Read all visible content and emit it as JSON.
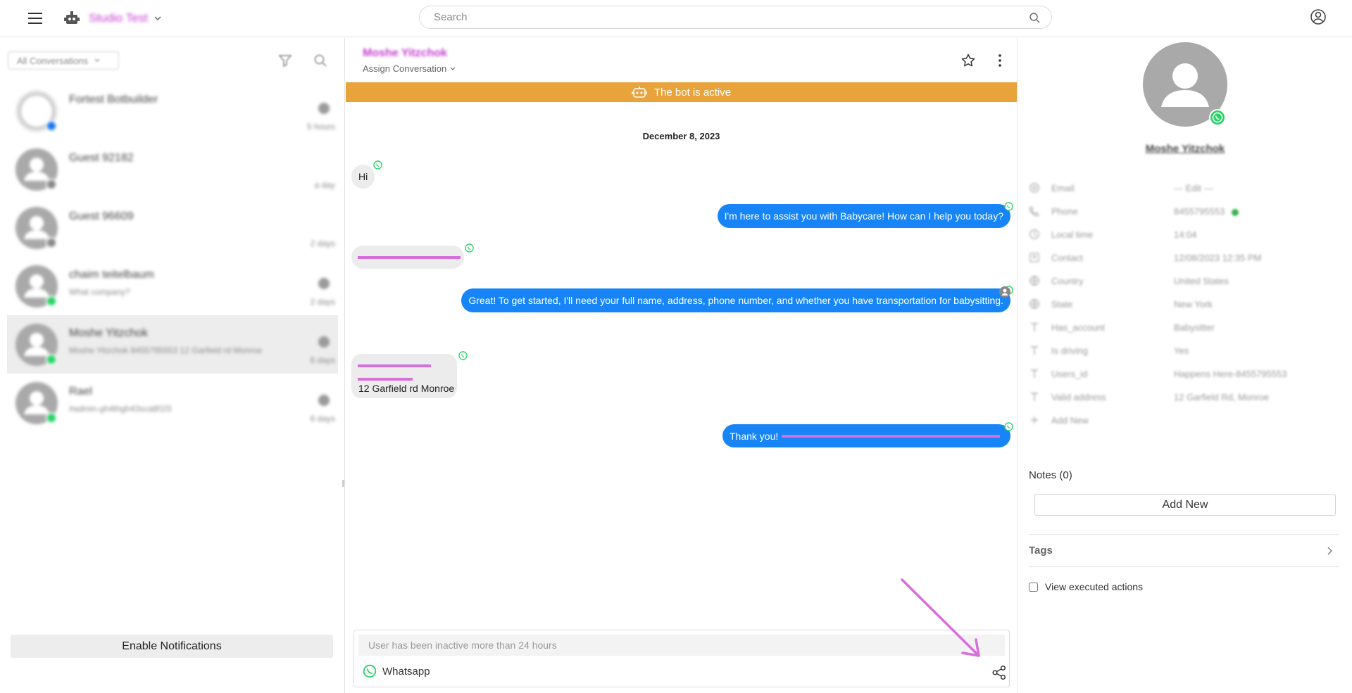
{
  "topbar": {
    "workspace_name": "Studio Test",
    "search_placeholder": "Search"
  },
  "left": {
    "filter_label": "All Conversations",
    "conversations": [
      {
        "name": "Fortest Botbuilder",
        "preview": "",
        "time": "5 hours",
        "channel": "messenger"
      },
      {
        "name": "Guest 92182",
        "preview": "",
        "time": "a day",
        "channel": "web"
      },
      {
        "name": "Guest 96609",
        "preview": "",
        "time": "2 days",
        "channel": "web"
      },
      {
        "name": "chaim teitelbaum",
        "preview": "What company?",
        "time": "2 days",
        "channel": "whatsapp"
      },
      {
        "name": "Moshe Yitzchok",
        "preview": "Moshe Yitzchok 8455795553 12 Garfield rd Monroe",
        "time": "6 days",
        "channel": "whatsapp"
      },
      {
        "name": "Rael",
        "preview": "#admin-gh4thgh43sca8f1f3",
        "time": "6 days",
        "channel": "whatsapp"
      }
    ],
    "notifications_button": "Enable Notifications"
  },
  "chat": {
    "contact_name": "Moshe Yitzchok",
    "assign_label": "Assign Conversation",
    "bot_banner": "The bot is active",
    "date_separator": "December 8, 2023",
    "messages": [
      {
        "dir": "in",
        "text": "Hi"
      },
      {
        "dir": "out",
        "text": "I'm here to assist you with Babycare! How can I help you today?"
      },
      {
        "dir": "in",
        "text": ""
      },
      {
        "dir": "out",
        "text": "Great! To get started, I'll need your full name, address, phone number, and whether you have transportation for babysitting."
      },
      {
        "dir": "in",
        "text": "12 Garfield rd Monroe"
      },
      {
        "dir": "out",
        "text": "Thank you!"
      }
    ],
    "composer_placeholder": "User has been inactive more than 24 hours",
    "channel_label": "Whatsapp"
  },
  "profile": {
    "name": "Moshe Yitzchok",
    "attributes": [
      {
        "icon": "email-icon",
        "key": "Email",
        "value": "--- Edit ---"
      },
      {
        "icon": "phone-icon",
        "key": "Phone",
        "value": "8455795553"
      },
      {
        "icon": "clock-icon",
        "key": "Local time",
        "value": "14:04"
      },
      {
        "icon": "contact-icon",
        "key": "Contact",
        "value": "12/08/2023 12:35 PM"
      },
      {
        "icon": "globe-icon",
        "key": "Country",
        "value": "United States"
      },
      {
        "icon": "globe-icon",
        "key": "State",
        "value": "New York"
      },
      {
        "icon": "text-icon",
        "key": "Has_account",
        "value": "Babysitter"
      },
      {
        "icon": "text-icon",
        "key": "Is driving",
        "value": "Yes"
      },
      {
        "icon": "text-icon",
        "key": "Users_id",
        "value": "Happens Here-8455795553"
      },
      {
        "icon": "text-icon",
        "key": "Valid address",
        "value": "12 Garfield Rd, Monroe"
      },
      {
        "icon": "plus-icon",
        "key": "Add New",
        "value": ""
      }
    ],
    "notes_title": "Notes (0)",
    "add_new_label": "Add New",
    "tags_label": "Tags",
    "executed_actions_label": "View executed actions"
  },
  "colors": {
    "accent_blue": "#1785f7",
    "bot_banner": "#e8a33a",
    "whatsapp_green": "#25d366",
    "annotation_pink": "#d66fd9"
  }
}
